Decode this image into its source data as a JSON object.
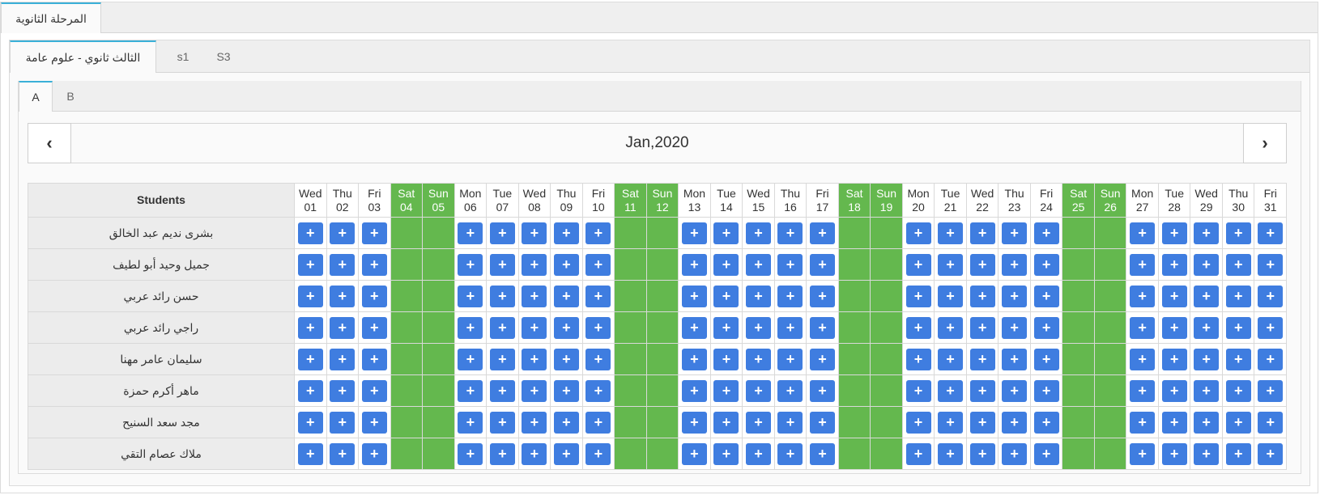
{
  "top_tabs": [
    {
      "label": "المرحلة الثانوية",
      "active": true
    }
  ],
  "class_tabs": [
    {
      "label": "الثالث ثانوي - علوم عامة",
      "active": true
    },
    {
      "label": "s1",
      "active": false
    },
    {
      "label": "S3",
      "active": false
    }
  ],
  "section_tabs": [
    {
      "label": "A",
      "active": true
    },
    {
      "label": "B",
      "active": false
    }
  ],
  "calendar": {
    "month_label": "Jan,2020",
    "prev_icon": "chevron-left-icon",
    "next_icon": "chevron-right-icon",
    "prev_glyph": "‹",
    "next_glyph": "›",
    "add_glyph": "+",
    "students_header": "Students",
    "days": [
      {
        "dow": "Wed",
        "d": "01",
        "weekend": false
      },
      {
        "dow": "Thu",
        "d": "02",
        "weekend": false
      },
      {
        "dow": "Fri",
        "d": "03",
        "weekend": false
      },
      {
        "dow": "Sat",
        "d": "04",
        "weekend": true
      },
      {
        "dow": "Sun",
        "d": "05",
        "weekend": true
      },
      {
        "dow": "Mon",
        "d": "06",
        "weekend": false
      },
      {
        "dow": "Tue",
        "d": "07",
        "weekend": false
      },
      {
        "dow": "Wed",
        "d": "08",
        "weekend": false
      },
      {
        "dow": "Thu",
        "d": "09",
        "weekend": false
      },
      {
        "dow": "Fri",
        "d": "10",
        "weekend": false
      },
      {
        "dow": "Sat",
        "d": "11",
        "weekend": true
      },
      {
        "dow": "Sun",
        "d": "12",
        "weekend": true
      },
      {
        "dow": "Mon",
        "d": "13",
        "weekend": false
      },
      {
        "dow": "Tue",
        "d": "14",
        "weekend": false
      },
      {
        "dow": "Wed",
        "d": "15",
        "weekend": false
      },
      {
        "dow": "Thu",
        "d": "16",
        "weekend": false
      },
      {
        "dow": "Fri",
        "d": "17",
        "weekend": false
      },
      {
        "dow": "Sat",
        "d": "18",
        "weekend": true
      },
      {
        "dow": "Sun",
        "d": "19",
        "weekend": true
      },
      {
        "dow": "Mon",
        "d": "20",
        "weekend": false
      },
      {
        "dow": "Tue",
        "d": "21",
        "weekend": false
      },
      {
        "dow": "Wed",
        "d": "22",
        "weekend": false
      },
      {
        "dow": "Thu",
        "d": "23",
        "weekend": false
      },
      {
        "dow": "Fri",
        "d": "24",
        "weekend": false
      },
      {
        "dow": "Sat",
        "d": "25",
        "weekend": true
      },
      {
        "dow": "Sun",
        "d": "26",
        "weekend": true
      },
      {
        "dow": "Mon",
        "d": "27",
        "weekend": false
      },
      {
        "dow": "Tue",
        "d": "28",
        "weekend": false
      },
      {
        "dow": "Wed",
        "d": "29",
        "weekend": false
      },
      {
        "dow": "Thu",
        "d": "30",
        "weekend": false
      },
      {
        "dow": "Fri",
        "d": "31",
        "weekend": false
      }
    ],
    "students": [
      "بشرى نديم عبد الخالق",
      "جميل وحيد أبو لطيف",
      "حسن رائد عربي",
      "راجي رائد عربي",
      "سليمان عامر مهنا",
      "ماهر أكرم حمزة",
      "مجد سعد السنيح",
      "ملاك عصام التقي"
    ]
  },
  "colors": {
    "weekend": "#64b84e",
    "add_button": "#3f7de0",
    "tab_accent": "#3ab0d8"
  }
}
